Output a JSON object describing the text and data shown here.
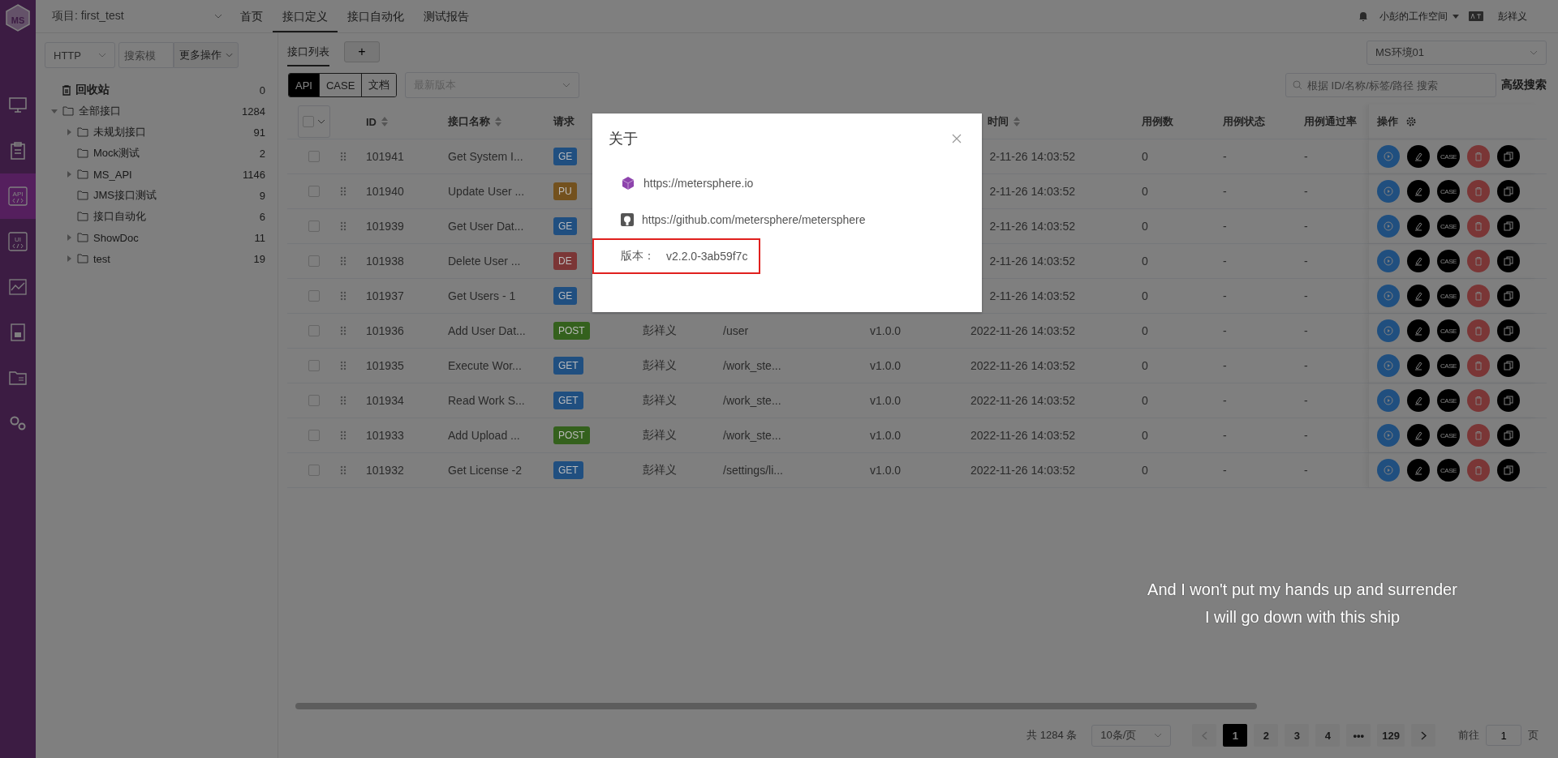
{
  "rail": {
    "logo": "MS",
    "items": [
      {
        "kind": "monitor",
        "selected": false
      },
      {
        "kind": "clipboard",
        "selected": false
      },
      {
        "kind": "api",
        "label": "API",
        "selected": true
      },
      {
        "kind": "ui",
        "label": "UI",
        "selected": false
      },
      {
        "kind": "chart",
        "selected": false
      },
      {
        "kind": "report",
        "selected": false
      },
      {
        "kind": "folder",
        "selected": false
      },
      {
        "kind": "gears",
        "selected": false
      }
    ]
  },
  "topbar": {
    "project": "项目: first_test",
    "nav": [
      {
        "label": "首页",
        "selected": false
      },
      {
        "label": "接口定义",
        "selected": true
      },
      {
        "label": "接口自动化",
        "selected": false
      },
      {
        "label": "测试报告",
        "selected": false
      }
    ],
    "workspace": "小彭的工作空间",
    "user": "彭祥义"
  },
  "tree_panel": {
    "protocol": "HTTP",
    "search": {
      "placeholder": "搜索模"
    },
    "more_button": "更多操作",
    "trash": {
      "label": "回收站",
      "count": "0"
    },
    "tree": [
      {
        "label": "全部接口",
        "count": "1284",
        "expandable": true,
        "expanded": true,
        "children": [
          {
            "label": "未规划接口",
            "count": "91",
            "expandable": true,
            "expanded": false
          },
          {
            "label": "Mock测试",
            "count": "2",
            "expandable": false
          },
          {
            "label": "MS_API",
            "count": "1146",
            "expandable": true,
            "expanded": false
          },
          {
            "label": "JMS接口测试",
            "count": "9",
            "expandable": false
          },
          {
            "label": "接口自动化",
            "count": "6",
            "expandable": false
          },
          {
            "label": "ShowDoc",
            "count": "11",
            "expandable": true,
            "expanded": false
          },
          {
            "label": "test",
            "count": "19",
            "expandable": true,
            "expanded": false
          }
        ]
      }
    ]
  },
  "main": {
    "tabs": [
      {
        "label": "接口列表",
        "selected": true
      }
    ],
    "add_tab": "+",
    "environment": "MS环境01",
    "modes": [
      {
        "label": "API",
        "selected": true
      },
      {
        "label": "CASE",
        "selected": false
      },
      {
        "label": "文档",
        "selected": false
      }
    ],
    "version_select": {
      "placeholder": "最新版本"
    },
    "search": {
      "placeholder": "根据 ID/名称/标签/路径 搜索"
    },
    "advanced_search": "高级搜索"
  },
  "table": {
    "select_all": {
      "checked": false
    },
    "header": {
      "id": "ID",
      "name": "接口名称",
      "method": "请求",
      "time": "时间",
      "case_count": "用例数",
      "case_status": "用例状态",
      "pass_rate": "用例通过率",
      "actions": "操作"
    },
    "rows": [
      {
        "checked": false,
        "id": "101941",
        "name": "Get System I...",
        "method": "GE",
        "color": "#204f80",
        "time": "2-11-26 14:03:52",
        "case_count": "0",
        "case_status": "-",
        "pass_rate": "-",
        "case_label": "CASE"
      },
      {
        "checked": false,
        "id": "101940",
        "name": "Update User ...",
        "method": "PU",
        "color": "#73511e",
        "time": "2-11-26 14:03:52",
        "case_count": "0",
        "case_status": "-",
        "pass_rate": "-",
        "case_label": "CASE"
      },
      {
        "checked": false,
        "id": "101939",
        "name": "Get User Dat...",
        "method": "GE",
        "color": "#204f80",
        "time": "2-11-26 14:03:52",
        "case_count": "0",
        "case_status": "-",
        "pass_rate": "-",
        "case_label": "CASE"
      },
      {
        "checked": false,
        "id": "101938",
        "name": "Delete User ...",
        "method": "DE",
        "color": "#7b3636",
        "time": "2-11-26 14:03:52",
        "case_count": "0",
        "case_status": "-",
        "pass_rate": "-",
        "case_label": "CASE"
      },
      {
        "checked": false,
        "id": "101937",
        "name": "Get Users - 1",
        "method": "GE",
        "color": "#204f80",
        "time": "2-11-26 14:03:52",
        "case_count": "0",
        "case_status": "-",
        "pass_rate": "-",
        "case_label": "CASE"
      },
      {
        "checked": false,
        "id": "101936",
        "name": "Add User Dat...",
        "method": "POST",
        "color": "#34611d",
        "owner": "彭祥义",
        "path": "/user",
        "version": "v1.0.0",
        "time": "2022-11-26 14:03:52",
        "case_count": "0",
        "case_status": "-",
        "pass_rate": "-",
        "case_label": "CASE"
      },
      {
        "checked": false,
        "id": "101935",
        "name": "Execute Wor...",
        "method": "GET",
        "color": "#204f80",
        "owner": "彭祥义",
        "path": "/work_ste...",
        "version": "v1.0.0",
        "time": "2022-11-26 14:03:52",
        "case_count": "0",
        "case_status": "-",
        "pass_rate": "-",
        "case_label": "CASE"
      },
      {
        "checked": false,
        "id": "101934",
        "name": "Read Work S...",
        "method": "GET",
        "color": "#204f80",
        "owner": "彭祥义",
        "path": "/work_ste...",
        "version": "v1.0.0",
        "time": "2022-11-26 14:03:52",
        "case_count": "0",
        "case_status": "-",
        "pass_rate": "-",
        "case_label": "CASE"
      },
      {
        "checked": false,
        "id": "101933",
        "name": "Add Upload ...",
        "method": "POST",
        "color": "#34611d",
        "owner": "彭祥义",
        "path": "/work_ste...",
        "version": "v1.0.0",
        "time": "2022-11-26 14:03:52",
        "case_count": "0",
        "case_status": "-",
        "pass_rate": "-",
        "case_label": "CASE"
      },
      {
        "checked": false,
        "id": "101932",
        "name": "Get License -2",
        "method": "GET",
        "color": "#204f80",
        "owner": "彭祥义",
        "path": "/settings/li...",
        "version": "v1.0.0",
        "time": "2022-11-26 14:03:52",
        "case_count": "0",
        "case_status": "-",
        "pass_rate": "-",
        "case_label": "CASE"
      }
    ]
  },
  "pagination": {
    "total": "共 1284 条",
    "page_size": "10条/页",
    "pages": [
      {
        "label": "1",
        "selected": true
      },
      {
        "label": "2",
        "selected": false
      },
      {
        "label": "3",
        "selected": false
      },
      {
        "label": "4",
        "selected": false
      },
      {
        "label": "•••",
        "selected": false
      },
      {
        "label": "129",
        "selected": false
      }
    ],
    "goto_label": "前往",
    "goto_value": "1",
    "page_unit": "页"
  },
  "dialog": {
    "title": "关于",
    "links": [
      {
        "kind": "site",
        "url": "https://metersphere.io"
      },
      {
        "kind": "github",
        "url": "https://github.com/metersphere/metersphere"
      }
    ],
    "version_label": "版本：",
    "version": "v2.2.0-3ab59f7c",
    "highlighted": true
  },
  "lyrics": [
    "And I won't put my hands up and surrender",
    "I will go down with this ship"
  ]
}
